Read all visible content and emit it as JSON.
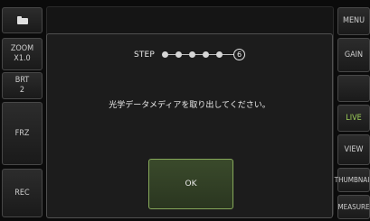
{
  "left_panel": {
    "zoom_label": "ZOOM\nX1.0",
    "brt_label": "BRT\n2",
    "frz_label": "FRZ",
    "rec_label": "REC"
  },
  "right_panel": {
    "menu_label": "MENU",
    "gain_label": "GAIN",
    "live_label": "LIVE",
    "view_label": "VIEW",
    "thumbnail_label": "THUMBNAIL",
    "measure_label": "MEASURE"
  },
  "dialog": {
    "step_label": "STEP",
    "step_current": "6",
    "step_total": 6,
    "message": "光学データメディアを取り出してください。",
    "ok_label": "OK"
  },
  "colors": {
    "accent_green": "#9fd05a",
    "ok_border": "#86a85a"
  },
  "icons": {
    "top_left": "folder-icon"
  }
}
